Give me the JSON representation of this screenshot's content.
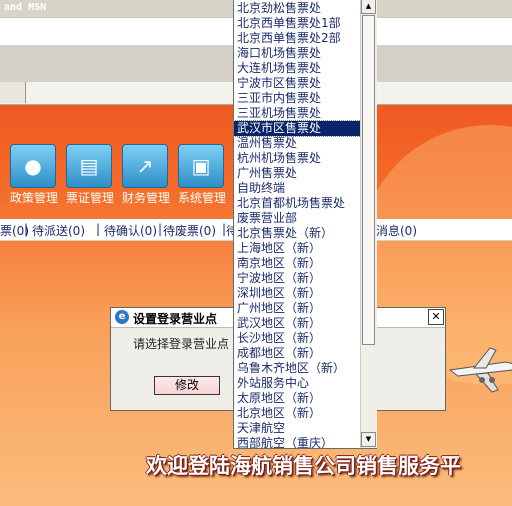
{
  "topbar": {
    "text": "and MSN"
  },
  "modules": [
    {
      "label": "政策管理",
      "icon": "policy-icon"
    },
    {
      "label": "票证管理",
      "icon": "ticket-icon"
    },
    {
      "label": "财务管理",
      "icon": "finance-icon"
    },
    {
      "label": "系统管理",
      "icon": "system-icon"
    }
  ],
  "status": {
    "items": [
      "票(0)",
      "待派送(0)",
      "待确认(0)",
      "待废票(0)",
      "待"
    ],
    "separator": "|",
    "tail": "消息(0)"
  },
  "welcome": "欢迎登陆海航销售公司销售服务平",
  "dialog": {
    "title": "设置登录营业点",
    "close": "✕",
    "prompt": "请选择登录营业点",
    "button": "修改"
  },
  "dropdown": {
    "selected_index": 8,
    "items": [
      "北京劲松售票处",
      "北京西单售票处1部",
      "北京西单售票处2部",
      "海口机场售票处",
      "大连机场售票处",
      "宁波市区售票处",
      "三亚市内售票处",
      "三亚机场售票处",
      "武汉市区售票处",
      "温州售票处",
      "杭州机场售票处",
      "广州售票处",
      "自助终端",
      "北京首都机场售票处",
      "废票营业部",
      "北京售票处（新）",
      "上海地区（新）",
      "南京地区（新）",
      "宁波地区（新）",
      "深圳地区（新）",
      "广州地区（新）",
      "武汉地区（新）",
      "长沙地区（新）",
      "成都地区（新）",
      "乌鲁木齐地区（新）",
      "外站服务中心",
      "太原地区（新）",
      "北京地区（新）",
      "天津航空",
      "西部航空（重庆）"
    ],
    "scroll_up": "▲",
    "scroll_down": "▼"
  }
}
